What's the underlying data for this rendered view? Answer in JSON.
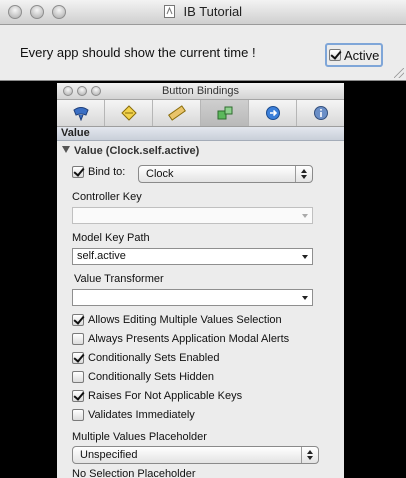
{
  "main_window": {
    "title": "IB Tutorial",
    "message": "Every app should show the current time !",
    "active_checkbox": {
      "label": "Active",
      "checked": true
    }
  },
  "inspector": {
    "title": "Button Bindings",
    "toolbar_tabs": [
      {
        "icon": "attributes-icon",
        "selected": false
      },
      {
        "icon": "effects-icon",
        "selected": false
      },
      {
        "icon": "size-icon",
        "selected": false
      },
      {
        "icon": "bindings-icon",
        "selected": true
      },
      {
        "icon": "connections-icon",
        "selected": false
      },
      {
        "icon": "identity-icon",
        "selected": false
      }
    ],
    "section_header": "Value",
    "binding_group_title": "Value (Clock.self.active)",
    "bind_to": {
      "label": "Bind to:",
      "checked": true,
      "value": "Clock"
    },
    "controller_key": {
      "label": "Controller Key",
      "value": ""
    },
    "model_key_path": {
      "label": "Model Key Path",
      "value": "self.active"
    },
    "value_transformer": {
      "label": "Value Transformer",
      "value": ""
    },
    "options": [
      {
        "label": "Allows Editing Multiple Values Selection",
        "checked": true
      },
      {
        "label": "Always Presents Application Modal Alerts",
        "checked": false
      },
      {
        "label": "Conditionally Sets Enabled",
        "checked": true
      },
      {
        "label": "Conditionally Sets Hidden",
        "checked": false
      },
      {
        "label": "Raises For Not Applicable Keys",
        "checked": true
      },
      {
        "label": "Validates Immediately",
        "checked": false
      }
    ],
    "multiple_values_placeholder": {
      "label": "Multiple Values Placeholder",
      "value": "Unspecified"
    },
    "no_selection_placeholder": {
      "label": "No Selection Placeholder"
    }
  },
  "colors": {
    "desktop": "#000000",
    "window_bg": "#ececec",
    "focus_ring": "#7fa6d8"
  }
}
